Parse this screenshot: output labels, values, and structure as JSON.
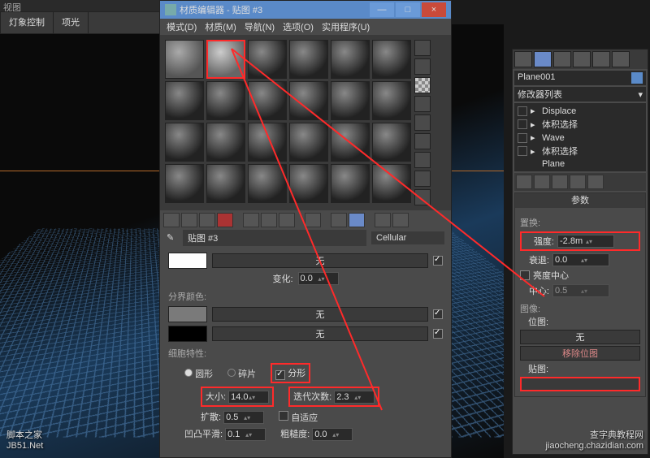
{
  "topbar": {
    "left_tab": "灯象控制",
    "right_tab": "项光",
    "view_label": "视图"
  },
  "material_editor": {
    "title": "材质编辑器 - 贴图 #3",
    "menu": [
      "模式(D)",
      "材质(M)",
      "导航(N)",
      "选项(O)",
      "实用程序(U)"
    ],
    "map_name": "贴图 #3",
    "map_type": "Cellular",
    "var_label": "变化:",
    "var_value": "0.0",
    "none_label": "无",
    "boundary_label": "分界颜色:",
    "cell_props_label": "细胞特性:",
    "shape_circle": "圆形",
    "shape_chip": "碎片",
    "shape_fractal": "分形",
    "size_label": "大小:",
    "size_value": "14.0",
    "iter_label": "迭代次数:",
    "iter_value": "2.3",
    "spread_label": "扩散:",
    "spread_value": "0.5",
    "adaptive_label": "自适应",
    "bump_label": "凹凸平滑:",
    "bump_value": "0.1",
    "rough_label": "粗糙度:",
    "rough_value": "0.0"
  },
  "command_panel": {
    "object_name": "Plane001",
    "modifier_list_label": "修改器列表",
    "modifiers": [
      "Displace",
      "体积选择",
      "Wave",
      "体积选择",
      "Plane"
    ],
    "rollout_title": "参数",
    "displace_label": "置换:",
    "strength_label": "强度:",
    "strength_value": "-2.8m",
    "decay_label": "衰退:",
    "decay_value": "0.0",
    "lum_center_label": "亮度中心",
    "center_label": "中心:",
    "center_value": "0.5",
    "image_label": "图像:",
    "bitmap_label": "位图:",
    "none_label": "无",
    "remove_map_label": "移除位图",
    "map_label": "贴图:"
  },
  "watermark1": {
    "line1": "脚本之家",
    "line2": "JB51.Net"
  },
  "watermark2": {
    "line1": "查字典教程网",
    "line2": "jiaocheng.chazidian.com"
  }
}
